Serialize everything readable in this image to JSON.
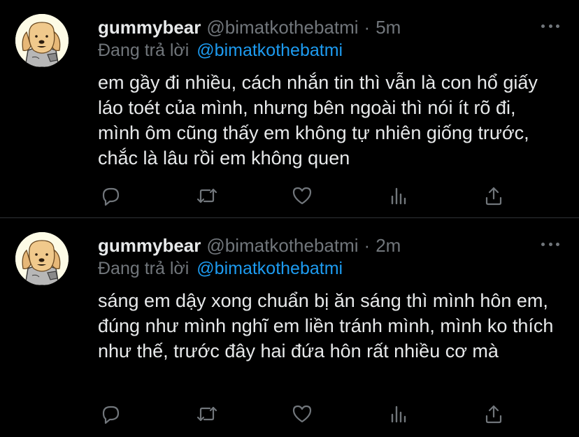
{
  "tweets": [
    {
      "display_name": "gummybear",
      "handle": "@bimatkothebatmi",
      "separator": "·",
      "time": "5m",
      "reply_prefix": "Đang trả lời",
      "reply_mention": "@bimatkothebatmi",
      "text": "em gầy đi nhiều, cách nhắn tin thì vẫn là con hổ giấy láo toét của mình, nhưng bên ngoài thì nói ít rõ đi, mình ôm cũng thấy em không tự nhiên giống trước, chắc là lâu rồi em không quen"
    },
    {
      "display_name": "gummybear",
      "handle": "@bimatkothebatmi",
      "separator": "·",
      "time": "2m",
      "reply_prefix": "Đang trả lời",
      "reply_mention": "@bimatkothebatmi",
      "text": "sáng em dậy xong chuẩn bị ăn sáng thì mình hôn em, đúng như mình nghĩ em liền tránh mình, mình ko thích như thế, trước đây hai đứa hôn rất nhiều cơ mà"
    }
  ],
  "icons": {
    "avatar": "dog-avatar-icon",
    "more": "more-dots-icon",
    "reply": "reply-icon",
    "retweet": "retweet-icon",
    "like": "heart-icon",
    "stats": "analytics-icon",
    "share": "share-icon"
  },
  "colors": {
    "background": "#000000",
    "text": "#e7e9ea",
    "muted": "#71767b",
    "link": "#1d9bf0",
    "divider": "#2f3336"
  }
}
